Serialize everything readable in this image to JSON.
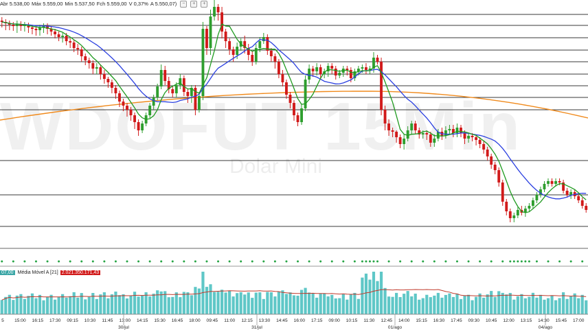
{
  "header": {
    "abr_label": "Abr 5.538,00",
    "max_label": "Máx 5.559,00",
    "min_label": "Min 5.537,50",
    "fch_label": "Fch 5.559,00",
    "var_label": "V 0,37%",
    "a_label": "A 5.550,07)",
    "buttons": [
      "−",
      "+",
      "+"
    ]
  },
  "watermark": {
    "symbol": "WDOFUT 15Min",
    "name": "Dolar Mini"
  },
  "volume_panel": {
    "volume_value": "07,00",
    "ma_label": "Média Móvel A [21]",
    "ma_value": "2.021.350.171,43"
  },
  "time_axis": {
    "labels": [
      "5",
      "15:00",
      "16:15",
      "17:30",
      "09:15",
      "10:30",
      "11:45",
      "13:00",
      "14:15",
      "15:30",
      "16:45",
      "18:00",
      "09:45",
      "11:00",
      "12:15",
      "13:30",
      "14:45",
      "16:00",
      "17:15",
      "09:00",
      "10:15",
      "11:30",
      "12:45",
      "14:00",
      "15:15",
      "16:30",
      "17:45",
      "09:30",
      "10:45",
      "12:00",
      "13:15",
      "14:30",
      "15:45",
      "17:00"
    ],
    "dates": [
      "30/jul",
      "31/jul",
      "01/ago",
      "04/ago"
    ]
  },
  "colors": {
    "up": "#2e9e2e",
    "down": "#d11a1a",
    "ma_fast": "#1f9a1f",
    "ma_mid": "#2a3fe0",
    "ma_slow": "#f08a1c",
    "vol_bar": "#5fc7c7",
    "vol_ma": "#c0392b",
    "dots": "#27a545"
  },
  "chart_data": {
    "type": "candlestick",
    "candles": [
      [
        190,
        188,
        180,
        195
      ],
      [
        188,
        186,
        176,
        192
      ],
      [
        186,
        184,
        176,
        190
      ],
      [
        184,
        182,
        175,
        188
      ],
      [
        182,
        185,
        172,
        190
      ],
      [
        185,
        182,
        175,
        189
      ],
      [
        182,
        184,
        174,
        188
      ],
      [
        184,
        180,
        172,
        187
      ],
      [
        180,
        178,
        170,
        184
      ],
      [
        178,
        176,
        168,
        182
      ],
      [
        176,
        180,
        168,
        184
      ],
      [
        180,
        182,
        172,
        186
      ],
      [
        182,
        178,
        170,
        186
      ],
      [
        178,
        174,
        168,
        182
      ],
      [
        174,
        170,
        164,
        178
      ],
      [
        170,
        166,
        160,
        174
      ],
      [
        166,
        168,
        158,
        172
      ],
      [
        168,
        160,
        154,
        172
      ],
      [
        160,
        158,
        150,
        164
      ],
      [
        158,
        150,
        144,
        162
      ],
      [
        150,
        148,
        140,
        156
      ],
      [
        148,
        138,
        130,
        152
      ],
      [
        138,
        132,
        125,
        142
      ],
      [
        132,
        128,
        120,
        136
      ],
      [
        128,
        120,
        112,
        132
      ],
      [
        120,
        122,
        112,
        128
      ],
      [
        122,
        112,
        104,
        126
      ],
      [
        112,
        105,
        98,
        118
      ],
      [
        105,
        100,
        92,
        108
      ],
      [
        100,
        92,
        84,
        104
      ],
      [
        92,
        84,
        76,
        96
      ],
      [
        84,
        72,
        64,
        88
      ],
      [
        72,
        66,
        58,
        76
      ],
      [
        66,
        60,
        50,
        70
      ],
      [
        60,
        52,
        44,
        64
      ],
      [
        52,
        42,
        32,
        56
      ],
      [
        42,
        30,
        22,
        46
      ],
      [
        30,
        40,
        26,
        44
      ],
      [
        40,
        52,
        36,
        56
      ],
      [
        52,
        66,
        48,
        70
      ],
      [
        66,
        78,
        60,
        82
      ],
      [
        78,
        94,
        74,
        98
      ],
      [
        94,
        118,
        90,
        126
      ],
      [
        118,
        102,
        96,
        124
      ],
      [
        102,
        90,
        84,
        108
      ],
      [
        90,
        84,
        78,
        94
      ],
      [
        84,
        96,
        78,
        100
      ],
      [
        96,
        106,
        90,
        112
      ],
      [
        106,
        86,
        80,
        110
      ],
      [
        86,
        80,
        70,
        90
      ],
      [
        80,
        92,
        70,
        96
      ],
      [
        92,
        60,
        52,
        96
      ],
      [
        60,
        80,
        56,
        86
      ],
      [
        80,
        178,
        74,
        188
      ],
      [
        178,
        150,
        140,
        182
      ],
      [
        150,
        196,
        140,
        206
      ],
      [
        196,
        210,
        190,
        222
      ],
      [
        210,
        202,
        190,
        214
      ],
      [
        202,
        174,
        164,
        210
      ],
      [
        174,
        160,
        150,
        178
      ],
      [
        160,
        148,
        140,
        164
      ],
      [
        148,
        140,
        130,
        152
      ],
      [
        140,
        152,
        134,
        158
      ],
      [
        152,
        160,
        146,
        164
      ],
      [
        160,
        150,
        142,
        168
      ],
      [
        150,
        140,
        132,
        156
      ],
      [
        140,
        130,
        124,
        146
      ],
      [
        130,
        150,
        126,
        156
      ],
      [
        150,
        160,
        144,
        166
      ],
      [
        160,
        166,
        156,
        172
      ],
      [
        166,
        146,
        140,
        170
      ],
      [
        146,
        138,
        130,
        150
      ],
      [
        138,
        130,
        120,
        142
      ],
      [
        130,
        112,
        106,
        134
      ],
      [
        112,
        100,
        94,
        118
      ],
      [
        100,
        82,
        76,
        104
      ],
      [
        82,
        70,
        62,
        86
      ],
      [
        70,
        52,
        44,
        74
      ],
      [
        52,
        42,
        36,
        56
      ],
      [
        42,
        62,
        38,
        68
      ],
      [
        62,
        104,
        58,
        110
      ],
      [
        104,
        120,
        98,
        126
      ],
      [
        120,
        116,
        108,
        124
      ],
      [
        116,
        122,
        110,
        128
      ],
      [
        122,
        112,
        104,
        126
      ],
      [
        112,
        116,
        106,
        120
      ],
      [
        116,
        124,
        108,
        128
      ],
      [
        124,
        120,
        112,
        128
      ],
      [
        120,
        110,
        104,
        124
      ],
      [
        110,
        114,
        106,
        118
      ],
      [
        114,
        120,
        108,
        124
      ],
      [
        120,
        118,
        110,
        124
      ],
      [
        118,
        106,
        100,
        122
      ],
      [
        106,
        116,
        102,
        120
      ],
      [
        116,
        120,
        110,
        124
      ],
      [
        120,
        122,
        114,
        126
      ],
      [
        122,
        118,
        112,
        128
      ],
      [
        118,
        120,
        112,
        124
      ],
      [
        120,
        136,
        114,
        144
      ],
      [
        136,
        130,
        126,
        140
      ],
      [
        130,
        60,
        52,
        136
      ],
      [
        60,
        40,
        30,
        66
      ],
      [
        40,
        30,
        22,
        46
      ],
      [
        30,
        28,
        20,
        34
      ],
      [
        28,
        20,
        12,
        30
      ],
      [
        20,
        10,
        4,
        24
      ],
      [
        10,
        18,
        2,
        24
      ],
      [
        18,
        30,
        14,
        36
      ],
      [
        30,
        40,
        24,
        44
      ],
      [
        40,
        30,
        24,
        44
      ],
      [
        30,
        24,
        18,
        34
      ],
      [
        24,
        26,
        18,
        30
      ],
      [
        26,
        24,
        16,
        30
      ],
      [
        24,
        12,
        6,
        28
      ],
      [
        12,
        18,
        6,
        24
      ],
      [
        18,
        28,
        14,
        32
      ],
      [
        28,
        22,
        16,
        34
      ],
      [
        22,
        30,
        18,
        36
      ],
      [
        30,
        32,
        24,
        38
      ],
      [
        32,
        26,
        20,
        38
      ],
      [
        26,
        34,
        20,
        40
      ],
      [
        34,
        26,
        20,
        38
      ],
      [
        26,
        18,
        10,
        30
      ],
      [
        18,
        22,
        12,
        26
      ],
      [
        22,
        20,
        14,
        26
      ],
      [
        20,
        16,
        8,
        22
      ],
      [
        16,
        10,
        4,
        20
      ],
      [
        10,
        2,
        -4,
        14
      ],
      [
        2,
        -8,
        -14,
        6
      ],
      [
        -8,
        -20,
        -26,
        -4
      ],
      [
        -20,
        -28,
        -34,
        -16
      ],
      [
        -28,
        -46,
        -52,
        -24
      ],
      [
        -46,
        -74,
        -80,
        -42
      ],
      [
        -74,
        -88,
        -94,
        -70
      ],
      [
        -88,
        -98,
        -104,
        -84
      ],
      [
        -98,
        -94,
        -104,
        -90
      ],
      [
        -94,
        -86,
        -98,
        -82
      ],
      [
        -86,
        -90,
        -94,
        -80
      ],
      [
        -90,
        -84,
        -96,
        -80
      ],
      [
        -84,
        -80,
        -88,
        -76
      ],
      [
        -80,
        -72,
        -84,
        -68
      ],
      [
        -72,
        -64,
        -76,
        -60
      ],
      [
        -64,
        -56,
        -68,
        -52
      ],
      [
        -56,
        -48,
        -60,
        -44
      ],
      [
        -48,
        -44,
        -52,
        -40
      ],
      [
        -44,
        -48,
        -52,
        -40
      ],
      [
        -48,
        -44,
        -52,
        -40
      ],
      [
        -44,
        -46,
        -50,
        -40
      ],
      [
        -46,
        -58,
        -62,
        -42
      ],
      [
        -58,
        -64,
        -68,
        -54
      ],
      [
        -64,
        -60,
        -70,
        -56
      ],
      [
        -60,
        -66,
        -70,
        -56
      ],
      [
        -66,
        -72,
        -76,
        -62
      ],
      [
        -72,
        -80,
        -84,
        -68
      ],
      [
        -80,
        -86,
        -90,
        -76
      ]
    ],
    "ma_slow_start": 175,
    "ma_slow_peak": 133,
    "ma_slow_end": 172,
    "price_lines": [
      21,
      37,
      55,
      73,
      90,
      108,
      125,
      142,
      160,
      234,
      284,
      330
    ]
  }
}
